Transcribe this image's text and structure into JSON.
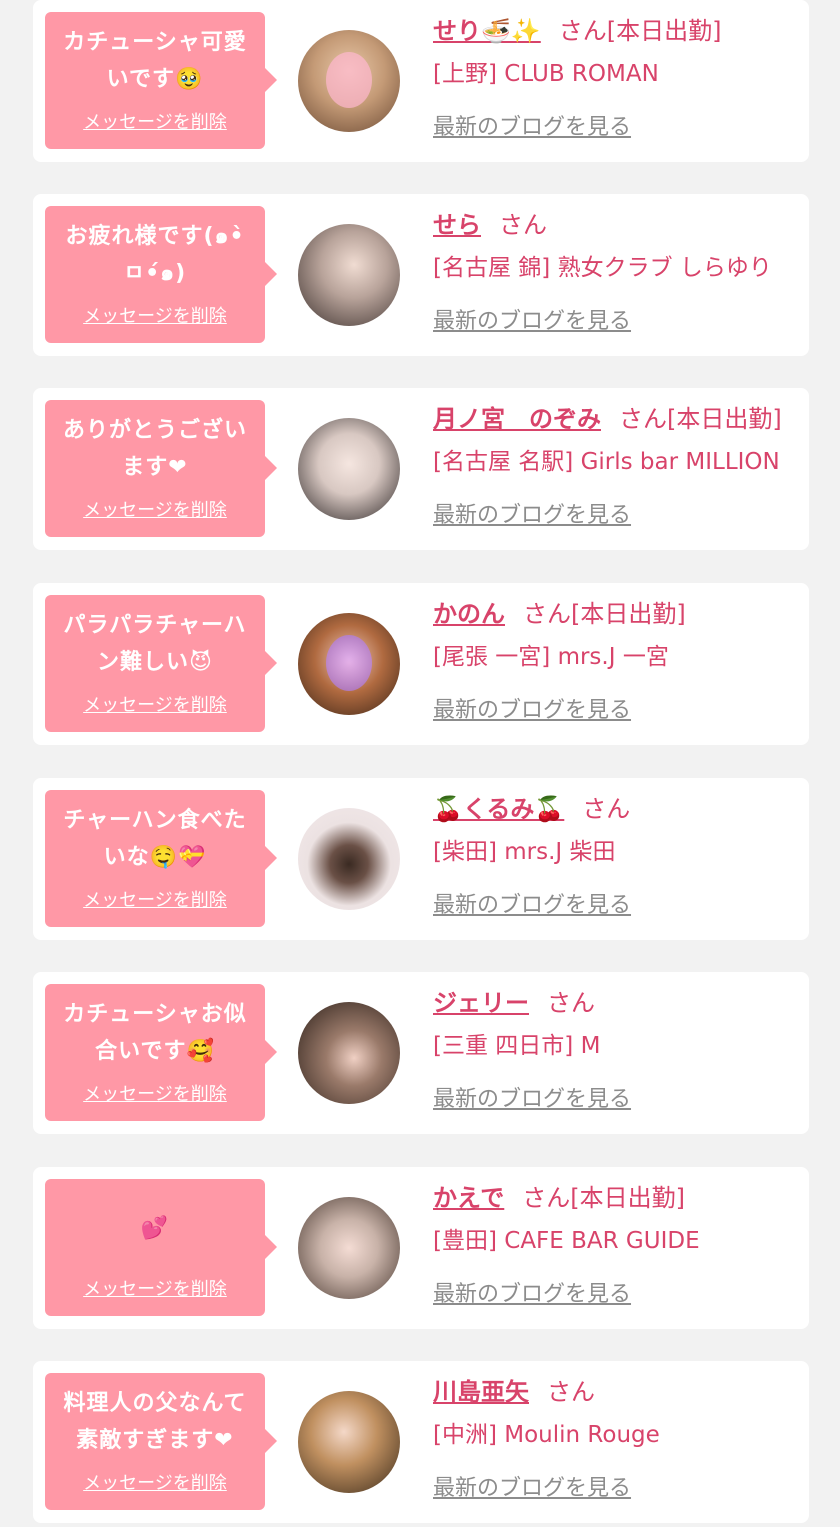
{
  "cards": [
    {
      "message": "カチューシャ可愛いです🥹",
      "delete_label": "メッセージを削除",
      "name": "せり🍜✨",
      "honorific": "さん",
      "status": "[本日出勤]",
      "shop": "[上野] CLUB ROMAN",
      "blog_label": "最新のブログを見る",
      "avatar_color": "#b8906a"
    },
    {
      "message": "お疲れ様です(๑•̀ㅁ•́๑)",
      "delete_label": "メッセージを削除",
      "name": "せら",
      "honorific": "さん",
      "status": "",
      "shop": "[名古屋 錦] 熟女クラブ しらゆり",
      "blog_label": "最新のブログを見る",
      "avatar_color": "#8a7d77"
    },
    {
      "message": "ありがとうございます❤",
      "delete_label": "メッセージを削除",
      "name": "月ノ宮　のぞみ",
      "honorific": "さん",
      "status": "[本日出勤]",
      "shop": "[名古屋 名駅] Girls bar MILLION",
      "blog_label": "最新のブログを見る",
      "avatar_color": "#c9bdb8"
    },
    {
      "message": "パラパラチャーハン難しい😈",
      "delete_label": "メッセージを削除",
      "name": "かのん",
      "honorific": "さん",
      "status": "[本日出勤]",
      "shop": "[尾張 一宮] mrs.J 一宮",
      "blog_label": "最新のブログを見る",
      "avatar_color": "#7a4a2c"
    },
    {
      "message": "チャーハン食べたいな🤤💝",
      "delete_label": "メッセージを削除",
      "name": "🍒くるみ🍒",
      "honorific": "さん",
      "status": "",
      "shop": "[柴田] mrs.J 柴田",
      "blog_label": "最新のブログを見る",
      "avatar_color": "#e9dedd"
    },
    {
      "message": "カチューシャお似合いです🥰",
      "delete_label": "メッセージを削除",
      "name": "ジェリー",
      "honorific": "さん",
      "status": "",
      "shop": "[三重 四日市] M",
      "blog_label": "最新のブログを見る",
      "avatar_color": "#5a4335"
    },
    {
      "message": "💕",
      "delete_label": "メッセージを削除",
      "name": "かえで",
      "honorific": "さん",
      "status": "[本日出勤]",
      "shop": "[豊田] CAFE BAR GUIDE",
      "blog_label": "最新のブログを見る",
      "avatar_color": "#c9c4c0"
    },
    {
      "message": "料理人の父なんて素敵すぎます❤",
      "delete_label": "メッセージを削除",
      "name": "川島亜矢",
      "honorific": "さん",
      "status": "",
      "shop": "[中洲] Moulin Rouge",
      "blog_label": "最新のブログを見る",
      "avatar_color": "#8a6a45"
    }
  ]
}
